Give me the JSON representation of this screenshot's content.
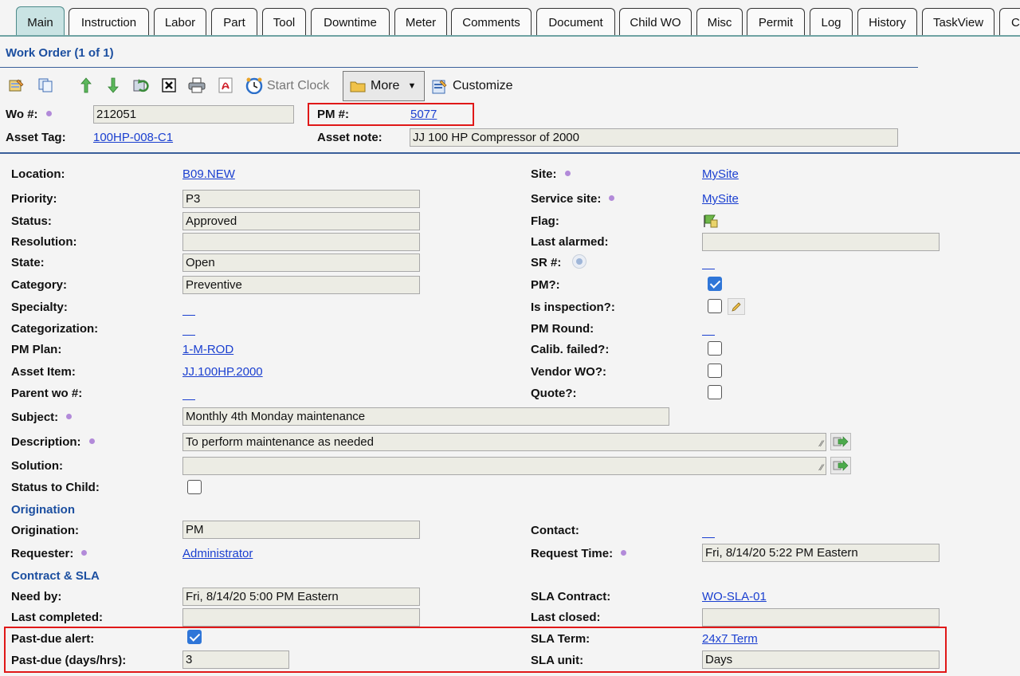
{
  "tabs": [
    "Main",
    "Instruction",
    "Labor",
    "Part",
    "Tool",
    "Downtime",
    "Meter",
    "Comments",
    "Document",
    "Child WO",
    "Misc",
    "Permit",
    "Log",
    "History",
    "TaskView",
    "Cu"
  ],
  "title": "Work Order (1 of 1)",
  "toolbar": {
    "start_clock": "Start Clock",
    "more": "More",
    "customize": "Customize"
  },
  "header": {
    "wo_label": "Wo #:",
    "wo_value": "212051",
    "pm_label": "PM #:",
    "pm_value": "5077",
    "asset_tag_label": "Asset Tag:",
    "asset_tag_value": "100HP-008-C1",
    "asset_note_label": "Asset note:",
    "asset_note_value": "JJ 100 HP Compressor of 2000"
  },
  "left": {
    "location_label": "Location:",
    "location_value": "B09.NEW",
    "priority_label": "Priority:",
    "priority_value": "P3",
    "status_label": "Status:",
    "status_value": "Approved",
    "resolution_label": "Resolution:",
    "resolution_value": "",
    "state_label": "State:",
    "state_value": "Open",
    "category_label": "Category:",
    "category_value": "Preventive",
    "specialty_label": "Specialty:",
    "categorization_label": "Categorization:",
    "pm_plan_label": "PM Plan:",
    "pm_plan_value": "1-M-ROD",
    "asset_item_label": "Asset Item:",
    "asset_item_value": "JJ.100HP.2000",
    "parent_wo_label": "Parent wo #:",
    "subject_label": "Subject:",
    "subject_value": "Monthly 4th Monday maintenance",
    "description_label": "Description:",
    "description_value": "To perform maintenance as needed",
    "solution_label": "Solution:",
    "solution_value": "",
    "status_to_child_label": "Status to Child:"
  },
  "right": {
    "site_label": "Site:",
    "site_value": "MySite",
    "service_site_label": "Service site:",
    "service_site_value": "MySite",
    "flag_label": "Flag:",
    "last_alarmed_label": "Last alarmed:",
    "last_alarmed_value": "",
    "sr_label": "SR #:",
    "pm_q_label": "PM?:",
    "is_inspection_label": "Is inspection?:",
    "pm_round_label": "PM Round:",
    "calib_label": "Calib. failed?:",
    "vendor_wo_label": "Vendor WO?:",
    "quote_label": "Quote?:"
  },
  "origination": {
    "section": "Origination",
    "origination_label": "Origination:",
    "origination_value": "PM",
    "requester_label": "Requester:",
    "requester_value": "Administrator",
    "contact_label": "Contact:",
    "request_time_label": "Request Time:",
    "request_time_value": "Fri, 8/14/20 5:22 PM Eastern"
  },
  "sla": {
    "section": "Contract & SLA",
    "need_by_label": "Need by:",
    "need_by_value": "Fri, 8/14/20 5:00 PM Eastern",
    "last_completed_label": "Last completed:",
    "last_completed_value": "",
    "past_due_alert_label": "Past-due alert:",
    "past_due_days_label": "Past-due (days/hrs):",
    "past_due_days_value": "3",
    "sla_contract_label": "SLA Contract:",
    "sla_contract_value": "WO-SLA-01",
    "last_closed_label": "Last closed:",
    "last_closed_value": "",
    "sla_term_label": "SLA Term:",
    "sla_term_value": "24x7 Term",
    "sla_unit_label": "SLA unit:",
    "sla_unit_value": "Days"
  }
}
